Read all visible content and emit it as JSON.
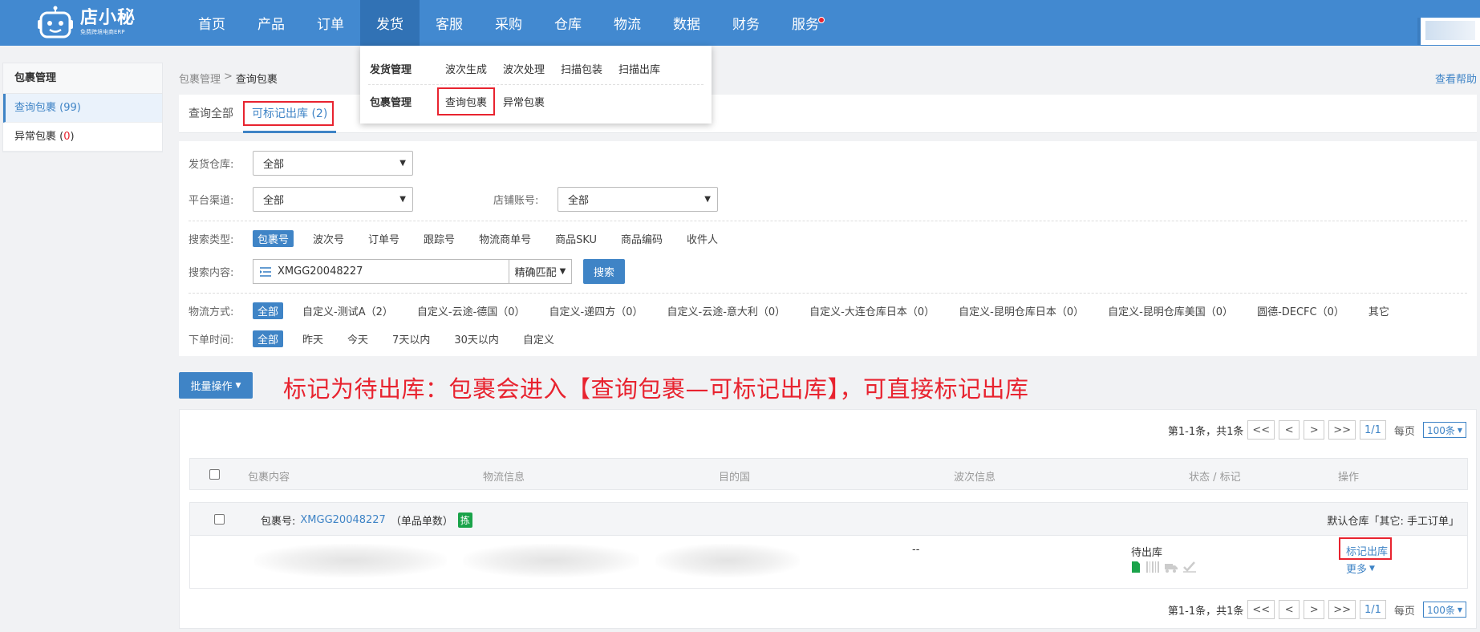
{
  "header": {
    "logo_main": "店小秘",
    "logo_sub": "免费跨境电商ERP",
    "nav": [
      {
        "label": "首页"
      },
      {
        "label": "产品"
      },
      {
        "label": "订单"
      },
      {
        "label": "发货"
      },
      {
        "label": "客服"
      },
      {
        "label": "采购"
      },
      {
        "label": "仓库"
      },
      {
        "label": "物流"
      },
      {
        "label": "数据"
      },
      {
        "label": "财务"
      },
      {
        "label": "服务"
      }
    ],
    "active_nav": "发货"
  },
  "dropdown": {
    "groups": [
      {
        "label": "发货管理",
        "links": [
          "波次生成",
          "波次处理",
          "扫描包装",
          "扫描出库"
        ]
      },
      {
        "label": "包裹管理",
        "links": [
          "查询包裹",
          "异常包裹"
        ]
      }
    ]
  },
  "sidebar": {
    "title": "包裹管理",
    "items": [
      {
        "label": "查询包裹 (99)"
      },
      {
        "label_prefix": "异常包裹 (",
        "count": "0",
        "label_suffix": ")"
      }
    ]
  },
  "breadcrumb": {
    "parent": "包裹管理",
    "sep": ">",
    "current": "查询包裹"
  },
  "help_link": "查看帮助",
  "tabs": [
    {
      "label": "查询全部"
    },
    {
      "label": "可标记出库 (2)"
    }
  ],
  "filters": {
    "warehouse_label": "发货仓库:",
    "warehouse_value": "全部",
    "platform_label": "平台渠道:",
    "platform_value": "全部",
    "shop_label": "店铺账号:",
    "shop_value": "全部",
    "search_type_label": "搜索类型:",
    "search_types": [
      "包裹号",
      "波次号",
      "订单号",
      "跟踪号",
      "物流商单号",
      "商品SKU",
      "商品编码",
      "收件人"
    ],
    "search_content_label": "搜索内容:",
    "search_value": "XMGG20048227",
    "match_mode": "精确匹配",
    "search_button": "搜索",
    "logistics_label": "物流方式:",
    "logistics_options": [
      "全部",
      "自定义-测试A（2）",
      "自定义-云途-德国（0）",
      "自定义-递四方（0）",
      "自定义-云途-意大利（0）",
      "自定义-大连仓库日本（0）",
      "自定义-昆明仓库日本（0）",
      "自定义-昆明仓库美国（0）",
      "圆德-DECFC（0）",
      "其它"
    ],
    "order_time_label": "下单时间:",
    "order_time_options": [
      "全部",
      "昨天",
      "今天",
      "7天以内",
      "30天以内",
      "自定义"
    ]
  },
  "batch_button": "批量操作",
  "notice": "标记为待出库：包裹会进入【查询包裹—可标记出库】，可直接标记出库",
  "pager": {
    "summary": "第1-1条，共1条",
    "first": "<<",
    "prev": "<",
    "next": ">",
    "last": ">>",
    "page": "1/1",
    "per_page_label": "每页",
    "per_page_value": "100条"
  },
  "table": {
    "columns": [
      "包裹内容",
      "物流信息",
      "目的国",
      "波次信息",
      "状态 / 标记",
      "操作"
    ],
    "group": {
      "package_label": "包裹号:",
      "package_no": "XMGG20048227",
      "unit_note": "（单品单数）",
      "tag": "拣",
      "warehouse_note": "默认仓库「其它: 手工订单」"
    },
    "row": {
      "wave": "--",
      "status": "待出库",
      "action_primary": "标记出库",
      "action_more": "更多"
    }
  },
  "colors": {
    "topbar": "#4289d0",
    "accent": "#3f84c6",
    "alert": "#e8232f",
    "tag_green": "#1aa34a"
  }
}
